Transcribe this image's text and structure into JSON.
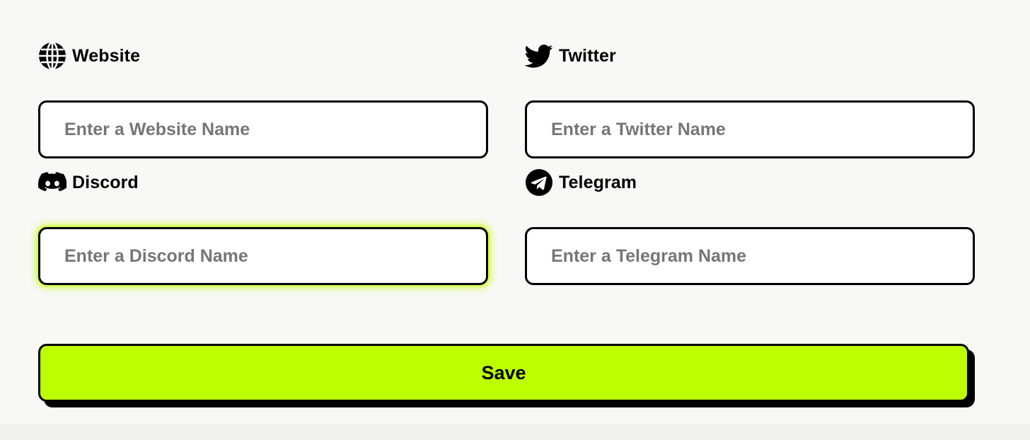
{
  "form": {
    "website": {
      "label": "Website",
      "icon": "globe-icon",
      "value": "",
      "placeholder": "Enter a Website Name"
    },
    "twitter": {
      "label": "Twitter",
      "icon": "twitter-bird-icon",
      "value": "",
      "placeholder": "Enter a Twitter Name"
    },
    "discord": {
      "label": "Discord",
      "icon": "discord-icon",
      "value": "",
      "placeholder": "Enter a Discord Name",
      "focused": true
    },
    "telegram": {
      "label": "Telegram",
      "icon": "telegram-icon",
      "value": "",
      "placeholder": "Enter a Telegram Name"
    },
    "save_label": "Save"
  },
  "colors": {
    "background": "#f8f8f4",
    "accent": "#bdff00",
    "border": "#000000",
    "placeholder": "#767676",
    "input_background": "#ffffff"
  }
}
